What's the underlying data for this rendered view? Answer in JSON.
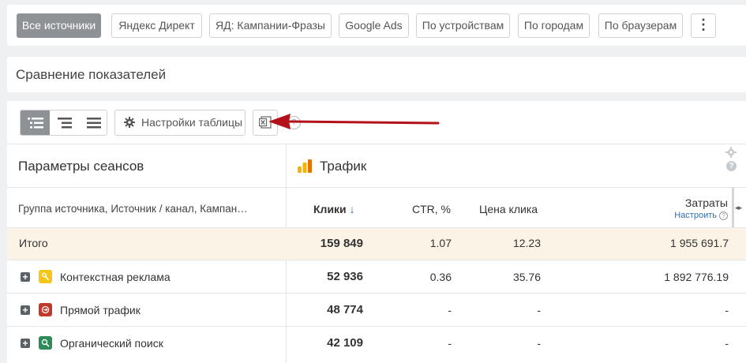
{
  "filters": {
    "chips": [
      "Все источники",
      "Яндекс Директ",
      "ЯД: Кампании-Фразы",
      "Google Ads",
      "По устройствам",
      "По городам",
      "По браузерам"
    ],
    "more_label": "⋮"
  },
  "section": {
    "title": "Сравнение показателей"
  },
  "toolbar": {
    "settings_label": "Настройки таблицы",
    "help_label": "?"
  },
  "table": {
    "group_title": "Параметры сеансов",
    "traffic_title": "Трафик",
    "columns": {
      "dimension": "Группа источника, Источник / канал, Кампан…",
      "clicks": "Клики",
      "sort_indicator": "↓",
      "ctr": "CTR, %",
      "cpc": "Цена клика",
      "cost": "Затраты",
      "cost_configure": "Настроить",
      "help": "?"
    },
    "total": {
      "label": "Итого",
      "clicks": "159 849",
      "ctr": "1.07",
      "cpc": "12.23",
      "cost": "1 955 691.7"
    },
    "rows": [
      {
        "label": "Контекстная реклама",
        "icon": "yandex-direct-icon",
        "color": "#f5c518",
        "clicks": "52 936",
        "ctr": "0.36",
        "cpc": "35.76",
        "cost": "1 892 776.19"
      },
      {
        "label": "Прямой трафик",
        "icon": "direct-traffic-icon",
        "color": "#c0392b",
        "clicks": "48 774",
        "ctr": "-",
        "cpc": "-",
        "cost": "-"
      },
      {
        "label": "Органический поиск",
        "icon": "organic-search-icon",
        "color": "#2e8b57",
        "clicks": "42 109",
        "ctr": "-",
        "cpc": "-",
        "cost": "-"
      }
    ]
  },
  "colors": {
    "active_chip": "#8e9297",
    "total_row": "#fbf3e6",
    "arrow": "#b3121b",
    "link": "#2f6fb0"
  }
}
